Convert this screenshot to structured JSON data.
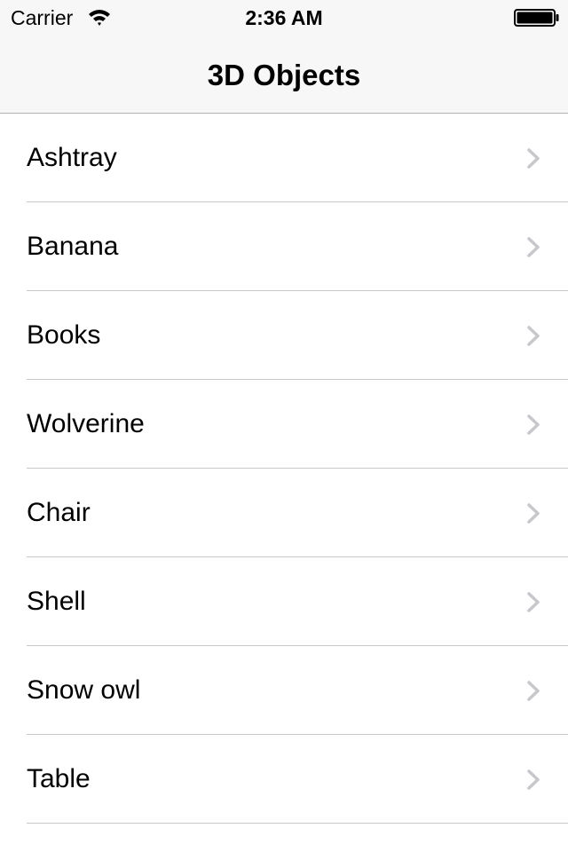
{
  "status_bar": {
    "carrier": "Carrier",
    "time": "2:36 AM",
    "wifi_icon": "wifi-icon",
    "battery_icon": "battery-full-icon"
  },
  "nav_bar": {
    "title": "3D Objects"
  },
  "list": {
    "items": [
      {
        "label": "Ashtray"
      },
      {
        "label": "Banana"
      },
      {
        "label": "Books"
      },
      {
        "label": "Wolverine"
      },
      {
        "label": "Chair"
      },
      {
        "label": "Shell"
      },
      {
        "label": "Snow owl"
      },
      {
        "label": "Table"
      }
    ],
    "disclosure_icon": "chevron-right-icon"
  },
  "colors": {
    "nav_background": "#f7f7f7",
    "nav_border": "#b2b2b2",
    "separator": "#c8c7cc",
    "chevron": "#c7c7cc",
    "text": "#000000",
    "background": "#ffffff"
  }
}
